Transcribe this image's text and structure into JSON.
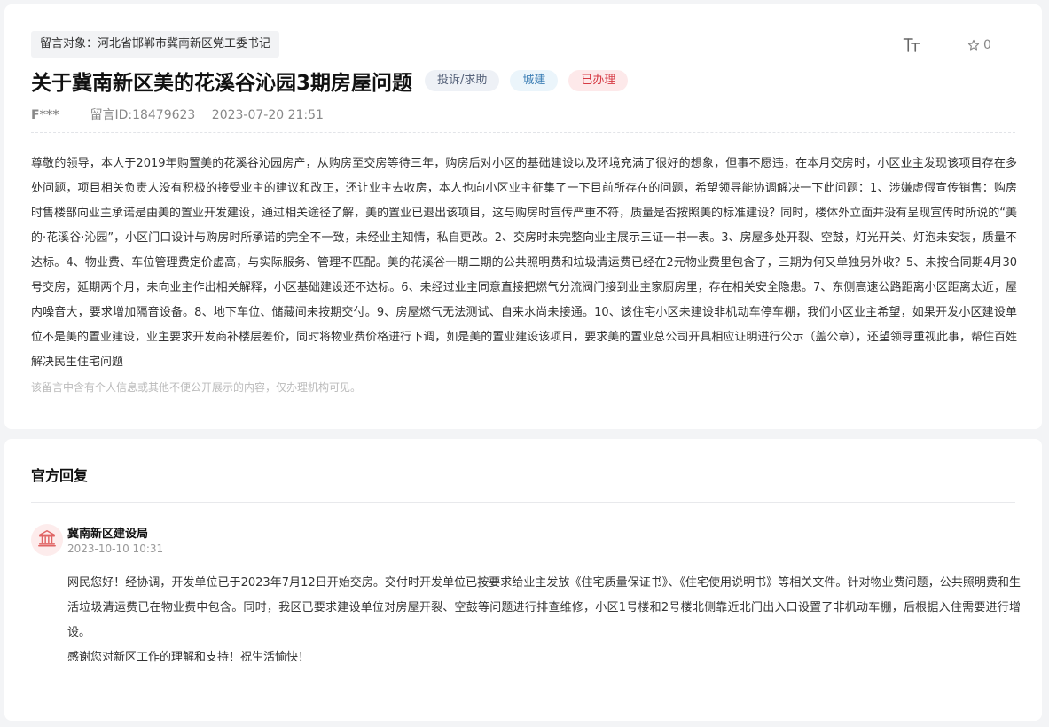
{
  "message": {
    "target_label": "留言对象：河北省邯郸市冀南新区党工委书记",
    "title": "关于冀南新区美的花溪谷沁园3期房屋问题",
    "tags": {
      "type": "投诉/求助",
      "field": "城建",
      "status": "已办理"
    },
    "author": "F***",
    "id_text": "留言ID:18479623",
    "datetime": "2023-07-20 21:51",
    "toolbar": {
      "font_icon": "font-size-icon",
      "star_icon": "star-icon",
      "star_count": "0"
    },
    "content": "尊敬的领导，本人于2019年购置美的花溪谷沁园房产，从购房至交房等待三年，购房后对小区的基础建设以及环境充满了很好的想象，但事不愿违，在本月交房时，小区业主发现该项目存在多处问题，项目相关负责人没有积极的接受业主的建议和改正，还让业主去收房，本人也向小区业主征集了一下目前所存在的问题，希望领导能协调解决一下此问题：1、涉嫌虚假宣传销售：购房时售楼部向业主承诺是由美的置业开发建设，通过相关途径了解，美的置业已退出该项目，这与购房时宣传严重不符，质量是否按照美的标准建设？同时，楼体外立面并没有呈现宣传时所说的“美的·花溪谷·沁园”，小区门口设计与购房时所承诺的完全不一致，未经业主知情，私自更改。2、交房时未完整向业主展示三证一书一表。3、房屋多处开裂、空鼓，灯光开关、灯泡未安装，质量不达标。4、物业费、车位管理费定价虚高，与实际服务、管理不匹配。美的花溪谷一期二期的公共照明费和垃圾清运费已经在2元物业费里包含了，三期为何又单独另外收？5、未按合同期4月30号交房，延期两个月，未向业主作出相关解释，小区基础建设还不达标。6、未经过业主同意直接把燃气分流阀门接到业主家厨房里，存在相关安全隐患。7、东侧高速公路距离小区距离太近，屋内噪音大，要求增加隔音设备。8、地下车位、储藏间未按期交付。9、房屋燃气无法测试、自来水尚未接通。10、该住宅小区未建设非机动车停车棚，我们小区业主希望，如果开发小区建设单位不是美的置业建设，业主要求开发商补楼层差价，同时将物业费价格进行下调，如是美的置业建设该项目，要求美的置业总公司开具相应证明进行公示（盖公章），还望领导重视此事，帮住百姓解决民生住宅问题",
    "privacy_note": "该留言中含有个人信息或其他不便公开展示的内容，仅办理机构可见。"
  },
  "reply": {
    "heading": "官方回复",
    "avatar_icon": "government-building-icon",
    "replier": "冀南新区建设局",
    "datetime": "2023-10-10 10:31",
    "paragraph_1": "网民您好！经协调，开发单位已于2023年7月12日开始交房。交付时开发单位已按要求给业主发放《住宅质量保证书》、《住宅使用说明书》等相关文件。针对物业费问题，公共照明费和生活垃圾清运费已在物业费中包含。同时，我区已要求建设单位对房屋开裂、空鼓等问题进行排查维修，小区1号楼和2号楼北侧靠近北门出入口设置了非机动车棚，后根据入住需要进行增设。",
    "paragraph_2": "感谢您对新区工作的理解和支持！祝生活愉快！"
  },
  "colors": {
    "page_bg": "#f3f4f6",
    "card_bg": "#ffffff",
    "status_red": "#d63a44",
    "field_blue": "#3d7fb5",
    "avatar_red": "#e06464"
  }
}
